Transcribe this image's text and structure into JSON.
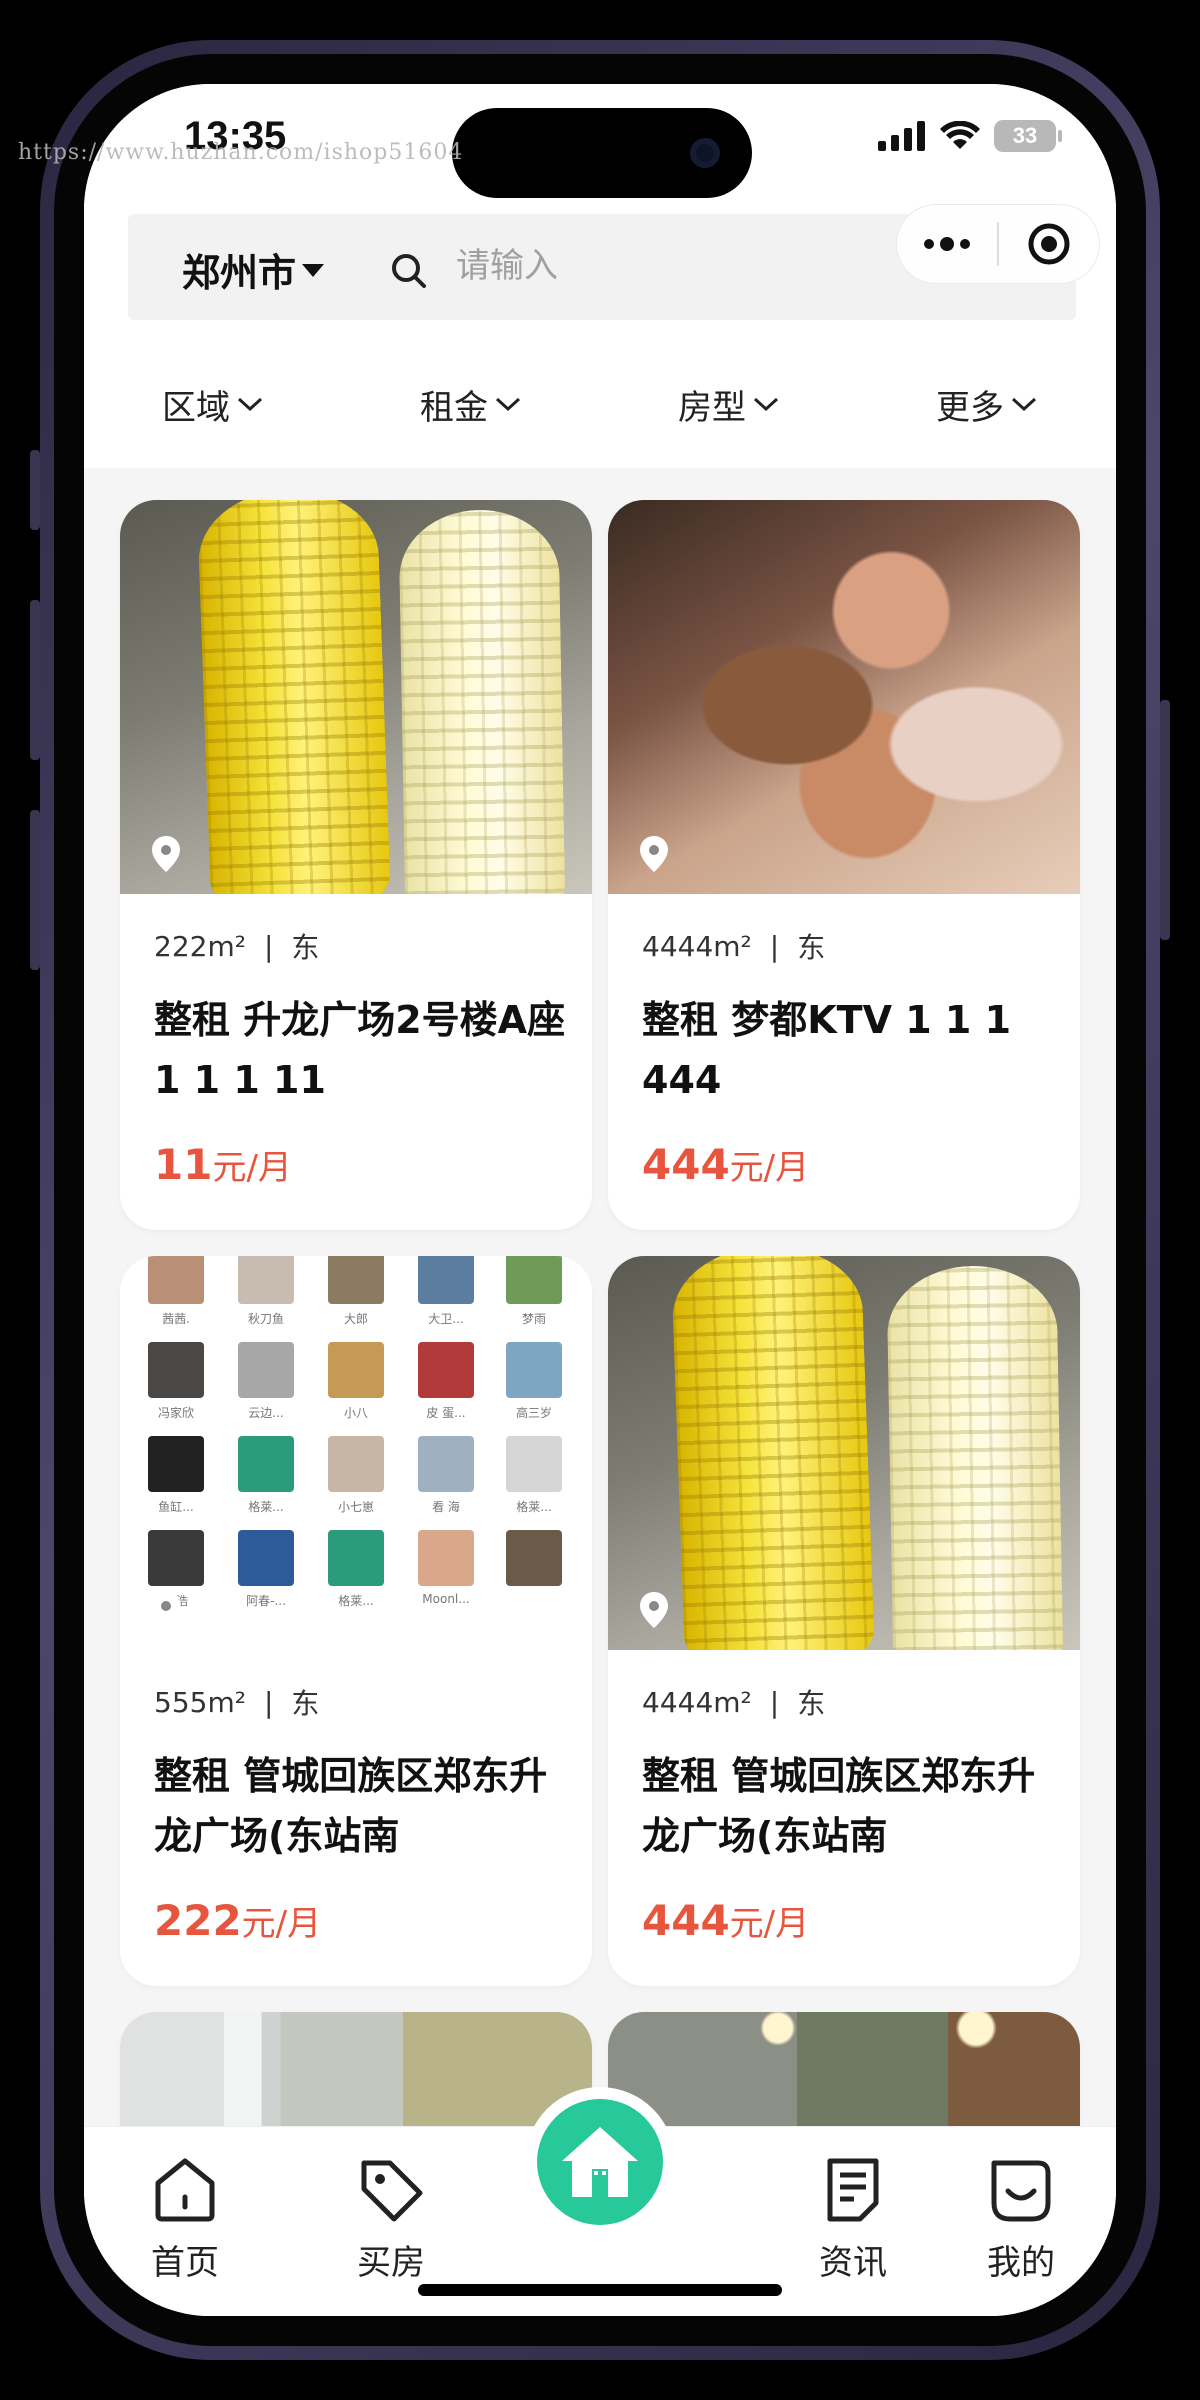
{
  "watermark": "https://www.huzhan.com/ishop51604",
  "status_bar": {
    "time": "13:35",
    "battery": "33"
  },
  "header": {
    "city": "郑州市",
    "search_placeholder": "请输入"
  },
  "filters": [
    {
      "label": "区域"
    },
    {
      "label": "租金"
    },
    {
      "label": "房型"
    },
    {
      "label": "更多"
    }
  ],
  "listings": [
    {
      "photo": "corn",
      "area": "222",
      "area_unit": "m²",
      "direction": "东",
      "title": "整租 升龙广场2号楼A座 1 1 1 11",
      "price": "11",
      "price_unit": "元/月"
    },
    {
      "photo": "couple",
      "area": "4444",
      "area_unit": "m²",
      "direction": "东",
      "title": "整租 梦都KTV 1 1 1 444",
      "price": "444",
      "price_unit": "元/月"
    },
    {
      "photo": "contacts",
      "area": "555",
      "area_unit": "m²",
      "direction": "东",
      "title": "整租 管城回族区郑东升龙广场(东站南",
      "price": "222",
      "price_unit": "元/月"
    },
    {
      "photo": "corn",
      "area": "4444",
      "area_unit": "m²",
      "direction": "东",
      "title": "整租 管城回族区郑东升龙广场(东站南",
      "price": "444",
      "price_unit": "元/月"
    }
  ],
  "contacts_photo": {
    "names": [
      "茜茜.",
      "秋刀鱼",
      "大郎",
      "大卫...",
      "梦雨",
      "冯家欣",
      "云边...",
      "小八",
      "皮 蛋...",
      "高三岁",
      "鱼缸...",
      "格莱...",
      "小七崽",
      "看 海",
      "格莱...",
      "栾浩",
      "阿春-...",
      "格莱...",
      "Moonl...",
      ""
    ]
  },
  "tabbar": {
    "items": [
      {
        "label": "首页",
        "icon": "home-outline-icon"
      },
      {
        "label": "买房",
        "icon": "tag-icon"
      },
      {
        "label": "资讯",
        "icon": "document-icon"
      },
      {
        "label": "我的",
        "icon": "smile-icon"
      }
    ],
    "center_icon": "home-filled-icon"
  },
  "colors": {
    "price": "#e8553f",
    "accent": "#27c99a",
    "background": "#f5f5f5"
  }
}
